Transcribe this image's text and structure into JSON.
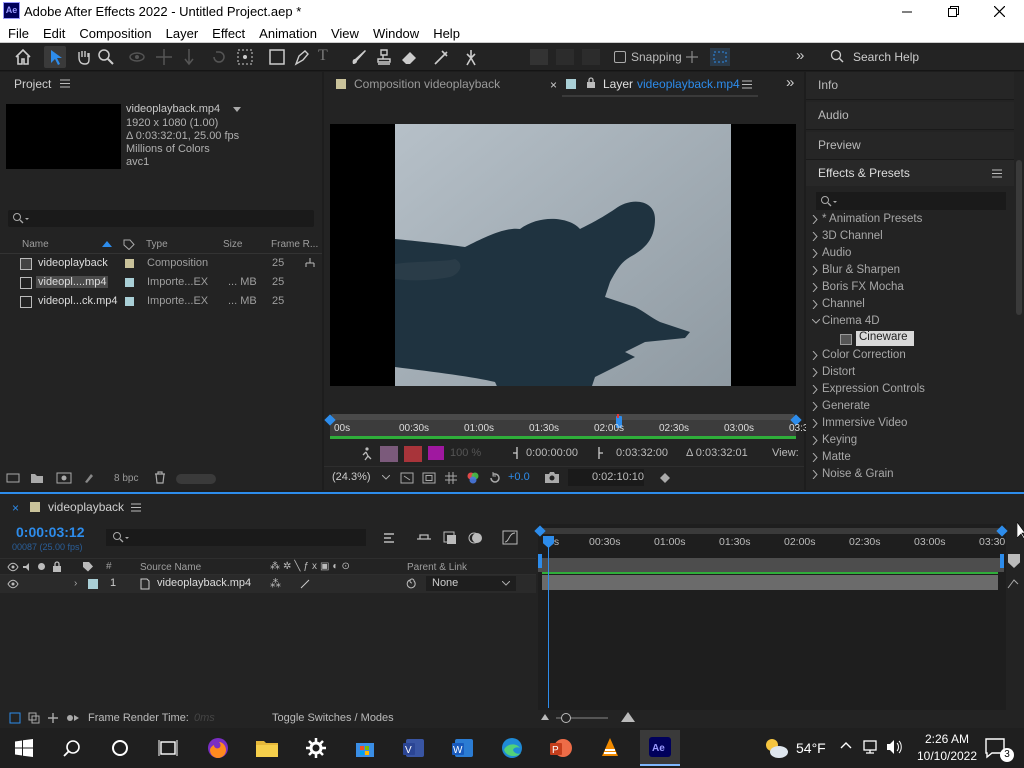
{
  "window": {
    "title": "Adobe After Effects 2022 - Untitled Project.aep *",
    "app_badge": "Ae"
  },
  "menu": [
    "File",
    "Edit",
    "Composition",
    "Layer",
    "Effect",
    "Animation",
    "View",
    "Window",
    "Help"
  ],
  "toolbar": {
    "snapping": "Snapping",
    "search_placeholder": "Search Help"
  },
  "project": {
    "title": "Project",
    "item_name": "videoplayback.mp4",
    "item_info": [
      "1920 x 1080 (1.00)",
      "Δ 0:03:32:01, 25.00 fps",
      "Millions of Colors",
      "avc1"
    ],
    "columns": {
      "name": "Name",
      "type": "Type",
      "size": "Size",
      "frame_rate": "Frame R..."
    },
    "rows": [
      {
        "name": "videoplayback",
        "type": "Composition",
        "size": "",
        "fps": "25",
        "color": "#c9c29a"
      },
      {
        "name": "videopl....mp4",
        "type": "Importe...EX",
        "size": "... MB",
        "fps": "25",
        "color": "#a9cfd6"
      },
      {
        "name": "videopl...ck.mp4",
        "type": "Importe...EX",
        "size": "... MB",
        "fps": "25",
        "color": "#a9cfd6"
      }
    ],
    "bpc": "8 bpc"
  },
  "viewer": {
    "comp_tab": "Composition videoplayback",
    "layer_tab_prefix": "Layer",
    "layer_tab_name": "videoplayback.mp4",
    "ruler": [
      "00s",
      "00:30s",
      "01:00s",
      "01:30s",
      "02:00s",
      "02:30s",
      "03:00s",
      "03:30s"
    ],
    "time_in": "0:00:00:00",
    "time_out": "0:03:32:00",
    "duration": "Δ 0:03:32:01",
    "view_label": "View:",
    "opacity": "100 %",
    "zoom": "(24.3%)",
    "exposure": "+0.0",
    "current_time": "0:02:10:10"
  },
  "right": {
    "panels": [
      "Info",
      "Audio",
      "Preview"
    ],
    "effects_title": "Effects & Presets",
    "items": [
      {
        "label": "* Animation Presets",
        "open": false
      },
      {
        "label": "3D Channel",
        "open": false
      },
      {
        "label": "Audio",
        "open": false
      },
      {
        "label": "Blur & Sharpen",
        "open": false
      },
      {
        "label": "Boris FX Mocha",
        "open": false
      },
      {
        "label": "Channel",
        "open": false
      },
      {
        "label": "Cinema 4D",
        "open": true
      },
      {
        "label": "Color Correction",
        "open": false
      },
      {
        "label": "Distort",
        "open": false
      },
      {
        "label": "Expression Controls",
        "open": false
      },
      {
        "label": "Generate",
        "open": false
      },
      {
        "label": "Immersive Video",
        "open": false
      },
      {
        "label": "Keying",
        "open": false
      },
      {
        "label": "Matte",
        "open": false
      },
      {
        "label": "Noise & Grain",
        "open": false
      }
    ],
    "selected_child": "Cineware"
  },
  "timeline": {
    "comp_name": "videoplayback",
    "timecode": "0:00:03:12",
    "frame_info": "00087 (25.00 fps)",
    "source_name_col": "Source Name",
    "parent_col": "Parent & Link",
    "ruler": [
      "0s",
      "00:30s",
      "01:00s",
      "01:30s",
      "02:00s",
      "02:30s",
      "03:00s",
      "03:30"
    ],
    "layer": {
      "num": "1",
      "name": "videoplayback.mp4",
      "parent": "None"
    },
    "render_time_label": "Frame Render Time:",
    "render_time_value": "0ms",
    "toggle": "Toggle Switches / Modes"
  },
  "taskbar": {
    "weather": "54°F",
    "time": "2:26 AM",
    "date": "10/10/2022",
    "notifications": "3"
  },
  "colors": {
    "accent": "#2d8ceb",
    "panel": "#232323",
    "bg": "#1d1d1d",
    "green": "#2fae3a"
  }
}
